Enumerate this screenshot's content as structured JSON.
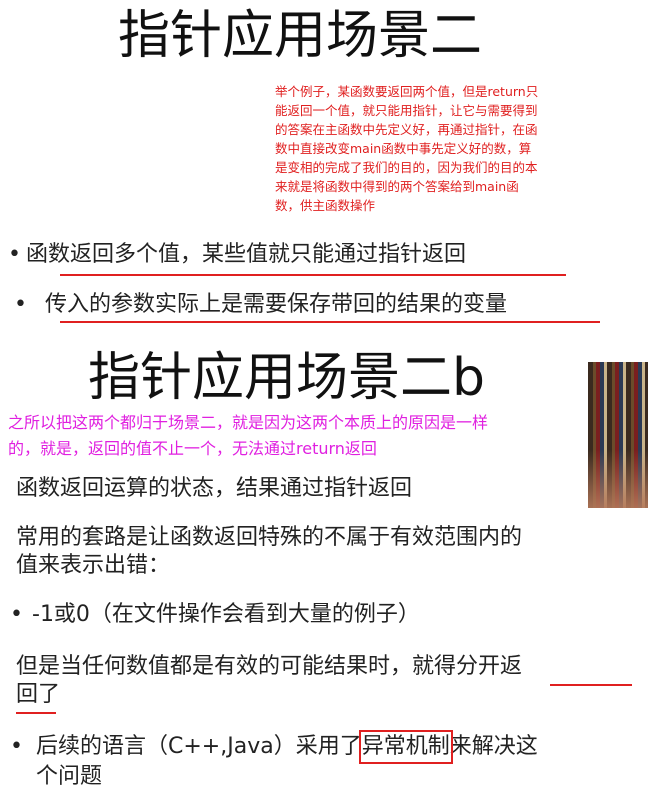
{
  "slide1": {
    "title": "指针应用场景二",
    "annotation": "举个例子，某函数要返回两个值，但是return只\n能返回一个值，就只能用指针，让它与需要得到\n的答案在主函数中先定义好，再通过指针，在函\n数中直接改变main函数中事先定义好的数，算\n是变相的完成了我们的目的，因为我们的目的本\n来就是将函数中得到的两个答案给到main函\n数，供主函数操作",
    "bullet1": "函数返回多个值，某些值就只能通过指针返回",
    "bullet2": "传入的参数实际上是需要保存带回的结果的变量"
  },
  "slide2": {
    "title": "指针应用场景二b",
    "annotation": "之所以把这两个都归于场景二，就是因为这两个本质上的原因是一样\n的，就是，返回的值不止一个，无法通过return返回",
    "line1": "函数返回运算的状态，结果通过指针返回",
    "line2a": "常用的套路是让函数返回特殊的不属于有效范围内的",
    "line2b": "值来表示出错：",
    "bullet1": "-1或0（在文件操作会看到大量的例子）",
    "line3a": "但是当任何数值都是有效的可能结果时，就得分开返",
    "line3b": "回了",
    "bullet2a_pre": "后续的语言（C++,Java）采用了",
    "bullet2a_box": "异常机制",
    "bullet2a_post": "来解决这",
    "bullet2b": "个问题",
    "bullet_mark": "•"
  },
  "colors": {
    "annotation_red": "#e02020",
    "annotation_pink": "#e020e0"
  }
}
